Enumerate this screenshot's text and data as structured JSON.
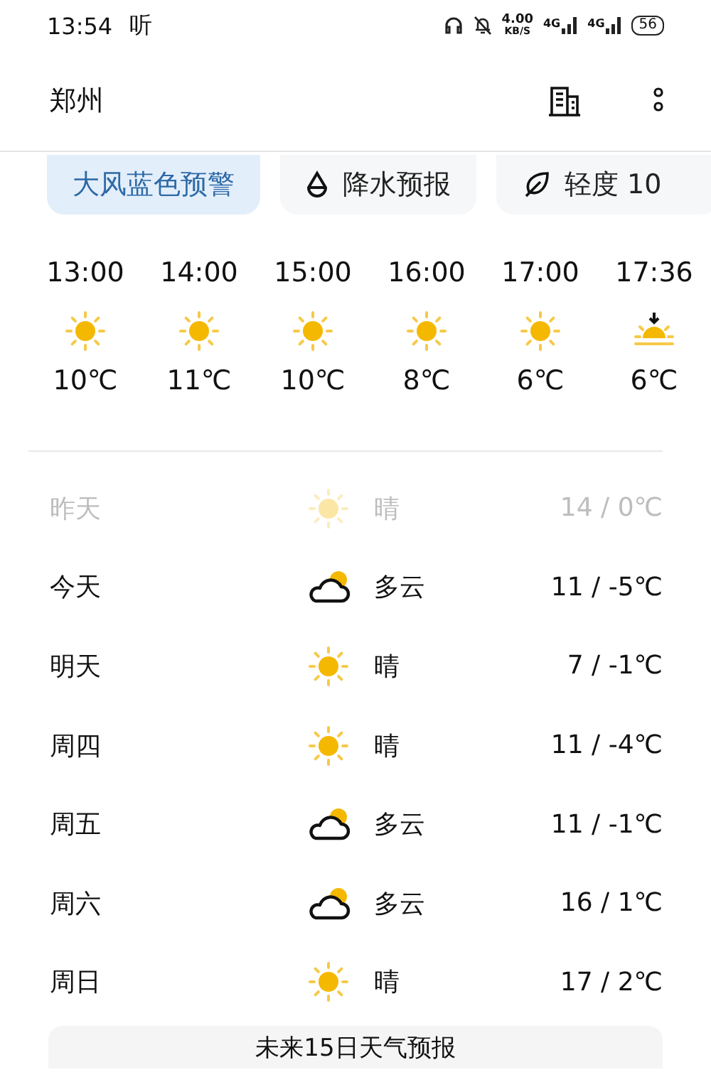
{
  "status_bar": {
    "time": "13:54",
    "app_mark": "听",
    "speed": "4.00",
    "speed_unit": "KB/S",
    "network_1": "4G",
    "network_2": "4G",
    "battery": "56"
  },
  "header": {
    "title": "郑州"
  },
  "chips": [
    {
      "kind": "warning",
      "label": "大风蓝色预警"
    },
    {
      "kind": "rain",
      "label": "降水预报"
    },
    {
      "kind": "air",
      "label": "轻度 10"
    }
  ],
  "hourly": [
    {
      "time": "13:00",
      "kind": "sunny",
      "temp": "10℃"
    },
    {
      "time": "14:00",
      "kind": "sunny",
      "temp": "11℃"
    },
    {
      "time": "15:00",
      "kind": "sunny",
      "temp": "10℃"
    },
    {
      "time": "16:00",
      "kind": "sunny",
      "temp": "8℃"
    },
    {
      "time": "17:00",
      "kind": "sunny",
      "temp": "6℃"
    },
    {
      "time": "17:36",
      "kind": "sunset",
      "temp": "6℃"
    }
  ],
  "daily": [
    {
      "day": "昨天",
      "kind": "sunny",
      "condition": "晴",
      "temps": "14 / 0℃",
      "past": true
    },
    {
      "day": "今天",
      "kind": "cloudy",
      "condition": "多云",
      "temps": "11 / -5℃",
      "past": false
    },
    {
      "day": "明天",
      "kind": "sunny",
      "condition": "晴",
      "temps": "7 / -1℃",
      "past": false
    },
    {
      "day": "周四",
      "kind": "sunny",
      "condition": "晴",
      "temps": "11 / -4℃",
      "past": false
    },
    {
      "day": "周五",
      "kind": "cloudy",
      "condition": "多云",
      "temps": "11 / -1℃",
      "past": false
    },
    {
      "day": "周六",
      "kind": "cloudy",
      "condition": "多云",
      "temps": "16 / 1℃",
      "past": false
    },
    {
      "day": "周日",
      "kind": "sunny",
      "condition": "晴",
      "temps": "17 / 2℃",
      "past": false
    }
  ],
  "forecast_button": "未来15日天气预报"
}
